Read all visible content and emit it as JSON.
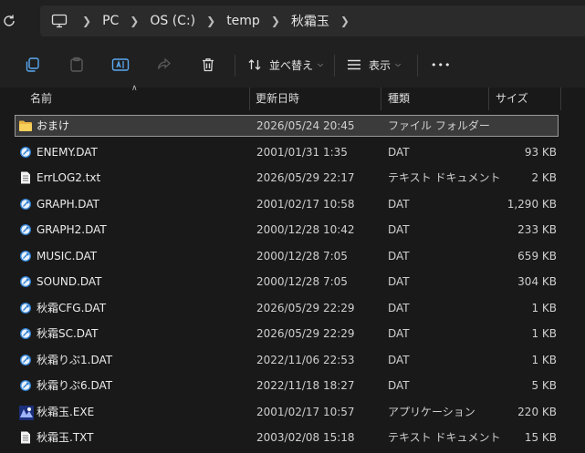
{
  "address": {
    "refresh_icon": "refresh-icon",
    "crumbs": [
      "PC",
      "OS (C:)",
      "temp",
      "秋霜玉"
    ]
  },
  "toolbar": {
    "sort_label": "並べ替え",
    "view_label": "表示",
    "more_label": "•••"
  },
  "columns": {
    "name": "名前",
    "date": "更新日時",
    "type": "種類",
    "size": "サイズ"
  },
  "files": [
    {
      "name": "おまけ",
      "date": "2026/05/24 20:45",
      "type": "ファイル フォルダー",
      "size": "",
      "icon": "folder",
      "selected": true
    },
    {
      "name": "ENEMY.DAT",
      "date": "2001/01/31 1:35",
      "type": "DAT",
      "size": "93 KB",
      "icon": "dat"
    },
    {
      "name": "ErrLOG2.txt",
      "date": "2026/05/29 22:17",
      "type": "テキスト ドキュメント",
      "size": "2 KB",
      "icon": "text"
    },
    {
      "name": "GRAPH.DAT",
      "date": "2001/02/17 10:58",
      "type": "DAT",
      "size": "1,290 KB",
      "icon": "dat"
    },
    {
      "name": "GRAPH2.DAT",
      "date": "2000/12/28 10:42",
      "type": "DAT",
      "size": "233 KB",
      "icon": "dat"
    },
    {
      "name": "MUSIC.DAT",
      "date": "2000/12/28 7:05",
      "type": "DAT",
      "size": "659 KB",
      "icon": "dat"
    },
    {
      "name": "SOUND.DAT",
      "date": "2000/12/28 7:05",
      "type": "DAT",
      "size": "304 KB",
      "icon": "dat"
    },
    {
      "name": "秋霜CFG.DAT",
      "date": "2026/05/29 22:29",
      "type": "DAT",
      "size": "1 KB",
      "icon": "dat"
    },
    {
      "name": "秋霜SC.DAT",
      "date": "2026/05/29 22:29",
      "type": "DAT",
      "size": "1 KB",
      "icon": "dat"
    },
    {
      "name": "秋霜りぷ1.DAT",
      "date": "2022/11/06 22:53",
      "type": "DAT",
      "size": "1 KB",
      "icon": "dat"
    },
    {
      "name": "秋霜りぷ6.DAT",
      "date": "2022/11/18 18:27",
      "type": "DAT",
      "size": "5 KB",
      "icon": "dat"
    },
    {
      "name": "秋霜玉.EXE",
      "date": "2001/02/17 10:57",
      "type": "アプリケーション",
      "size": "220 KB",
      "icon": "exe"
    },
    {
      "name": "秋霜玉.TXT",
      "date": "2003/02/08 15:18",
      "type": "テキスト ドキュメント",
      "size": "15 KB",
      "icon": "text"
    }
  ]
}
